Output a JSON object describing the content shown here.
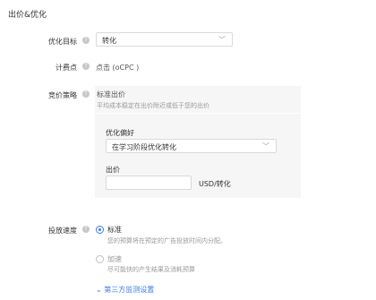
{
  "section_title": "出价&优化",
  "optimization_goal": {
    "label": "优化目标",
    "value": "转化"
  },
  "billing_point": {
    "label": "计费点",
    "value": "点击 (oCPC )"
  },
  "bidding_strategy": {
    "label": "竞价策略",
    "title": "标准出价",
    "description": "平均成本稳定在出价附近或低于您的出价",
    "preference_label": "优化偏好",
    "preference_value": "在学习阶段优化转化",
    "bid_label": "出价",
    "bid_value": "",
    "bid_unit": "USD/转化"
  },
  "delivery_speed": {
    "label": "投放速度",
    "options": [
      {
        "title": "标准",
        "description": "您的预算将在预定的广告投放时间内分配。",
        "selected": true
      },
      {
        "title": "加速",
        "description": "尽可能快的产生结果及消耗预算",
        "selected": false
      }
    ]
  },
  "third_party_link": "第三方监测设置",
  "icons": {
    "help": "help-circle-icon",
    "chevron": "chevron-down-icon",
    "double_chevron": "double-chevron-down-icon"
  },
  "colors": {
    "accent": "#3d7be8",
    "panel_bg": "#f6f6f6",
    "muted_text": "#999999"
  }
}
